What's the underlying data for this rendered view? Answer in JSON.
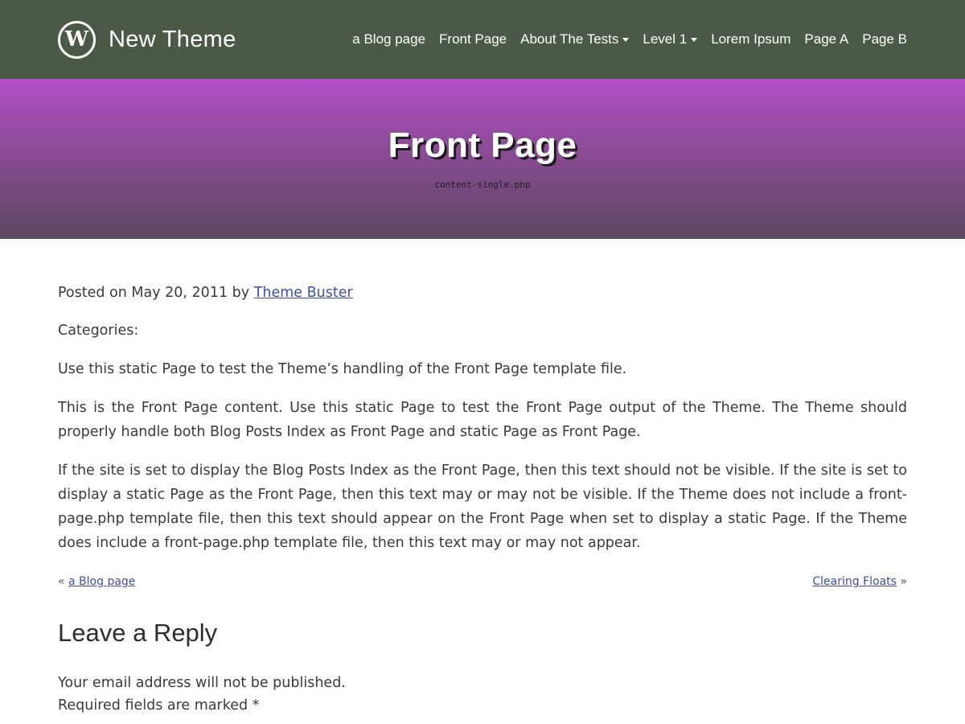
{
  "header": {
    "site_title": "New Theme",
    "logo_letter": "W",
    "nav": [
      {
        "label": "a Blog page",
        "dropdown": false
      },
      {
        "label": "Front Page",
        "dropdown": false
      },
      {
        "label": "About The Tests",
        "dropdown": true
      },
      {
        "label": "Level 1",
        "dropdown": true
      },
      {
        "label": "Lorem Ipsum",
        "dropdown": false
      },
      {
        "label": "Page A",
        "dropdown": false
      },
      {
        "label": "Page B",
        "dropdown": false
      }
    ]
  },
  "hero": {
    "title": "Front Page",
    "template_file": "content-single.php"
  },
  "post": {
    "posted_prefix": "Posted on May 20, 2011 by ",
    "author": "Theme Buster",
    "categories_label": "Categories:",
    "paragraphs": [
      "Use this static Page to test the Theme’s handling of the Front Page template file.",
      "This is the Front Page content. Use this static Page to test the Front Page output of the Theme. The Theme should properly handle both Blog Posts Index as Front Page and static Page as Front Page.",
      "If the site is set to display the Blog Posts Index as the Front Page, then this text should not be visible. If the site is set to display a static Page as the Front Page, then this text may or may not be visible. If the Theme does not include a front-page.php template file, then this text should appear on the Front Page when set to display a static Page. If the Theme does include a front-page.php template file, then this text may or may not appear."
    ]
  },
  "post_nav": {
    "prev_arrow": "«",
    "prev_label": "a Blog page",
    "next_label": "Clearing Floats",
    "next_arrow": "»"
  },
  "reply": {
    "title": "Leave a Reply",
    "email_note": "Your email address will not be published.",
    "required_note": "Required fields are marked *"
  },
  "colors": {
    "navbar": "#4a5a47",
    "hero_top": "#b24fc8",
    "hero_bottom": "#5c4760",
    "link": "#3d4db0"
  }
}
